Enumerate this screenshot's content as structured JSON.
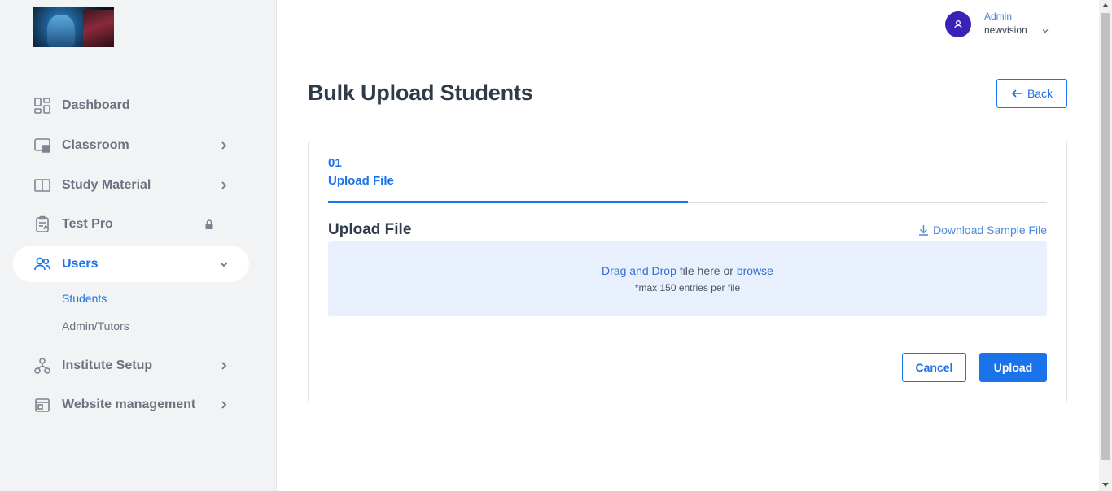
{
  "sidebar": {
    "items": [
      {
        "label": "Dashboard",
        "icon": "dashboard-icon"
      },
      {
        "label": "Classroom",
        "icon": "classroom-icon"
      },
      {
        "label": "Study Material",
        "icon": "book-icon"
      },
      {
        "label": "Test Pro",
        "icon": "clipboard-icon",
        "badge_icon": "lock-icon"
      },
      {
        "label": "Users",
        "icon": "users-icon",
        "active": true
      },
      {
        "label": "Institute Setup",
        "icon": "hierarchy-icon"
      },
      {
        "label": "Website management",
        "icon": "website-icon"
      }
    ],
    "users_sub": [
      {
        "label": "Students",
        "active": true
      },
      {
        "label": "Admin/Tutors"
      }
    ]
  },
  "header": {
    "user_role": "Admin",
    "user_name": "newvision"
  },
  "main": {
    "title": "Bulk Upload Students",
    "back_label": "Back",
    "step": {
      "number": "01",
      "label": "Upload File"
    },
    "section_title": "Upload File",
    "download_label": "Download Sample File",
    "dropzone": {
      "drag_text": "Drag and Drop",
      "middle_text": " file here or ",
      "browse_text": "browse",
      "note": "*max 150 entries per file"
    },
    "cancel_label": "Cancel",
    "upload_label": "Upload"
  },
  "colors": {
    "accent": "#1a73e8",
    "avatar": "#3a22b6",
    "dropzone_bg": "#e8f0fd",
    "sidebar_bg": "#f2f3f5"
  }
}
